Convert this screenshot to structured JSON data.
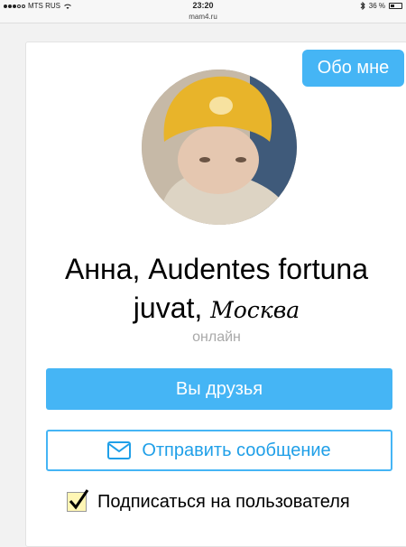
{
  "status_bar": {
    "carrier": "MTS RUS",
    "time": "23:20",
    "battery_percent": "36 %"
  },
  "browser": {
    "url": "mam4.ru"
  },
  "profile": {
    "about_button": "Обо мне",
    "name": "Анна, Audentes fortuna juvat,",
    "city": "Москва",
    "online_status": "онлайн",
    "friends_button": "Вы друзья",
    "message_button": "Отправить сообщение",
    "subscribe_label": "Подписаться на пользователя",
    "subscribe_checked": true
  },
  "colors": {
    "accent": "#45b5f5",
    "accent_text": "#1f9fe8",
    "checkbox_bg": "#fff6b5"
  }
}
